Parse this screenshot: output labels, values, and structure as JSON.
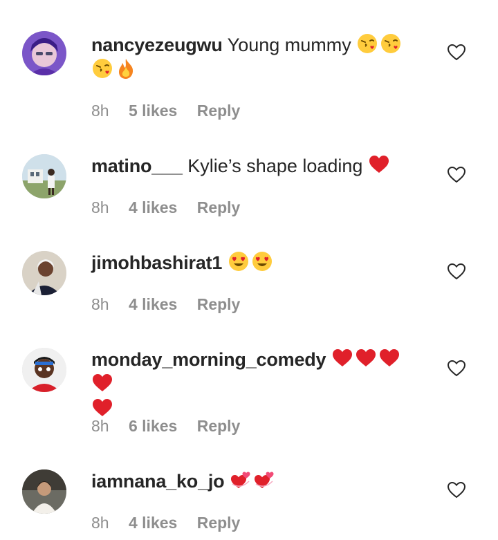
{
  "comments": [
    {
      "username": "nancyezeugwu",
      "text": "Young mummy",
      "emojis": [
        "kissing-face-icon",
        "kissing-face-icon",
        "kissing-face-icon",
        "fire-icon"
      ],
      "time": "8h",
      "likes": "5 likes",
      "reply": "Reply"
    },
    {
      "username": "matino___",
      "text": "Kylie’s shape loading",
      "emojis": [
        "red-heart-icon"
      ],
      "time": "8h",
      "likes": "4 likes",
      "reply": "Reply"
    },
    {
      "username": "jimohbashirat1",
      "text": "",
      "emojis": [
        "heart-eyes-face-icon",
        "heart-eyes-face-icon"
      ],
      "time": "8h",
      "likes": "4 likes",
      "reply": "Reply"
    },
    {
      "username": "monday_morning_comedy",
      "text": "",
      "emojis": [
        "red-heart-icon",
        "red-heart-icon",
        "red-heart-icon",
        "red-heart-icon",
        "red-heart-icon"
      ],
      "time": "8h",
      "likes": "6 likes",
      "reply": "Reply"
    },
    {
      "username": "iamnana_ko_jo",
      "text": "",
      "emojis": [
        "revolving-hearts-icon",
        "revolving-hearts-icon"
      ],
      "time": "8h",
      "likes": "4 likes",
      "reply": "Reply"
    }
  ],
  "colors": {
    "text": "#262626",
    "meta": "#8e8e8e",
    "heart": "#e0202a"
  }
}
